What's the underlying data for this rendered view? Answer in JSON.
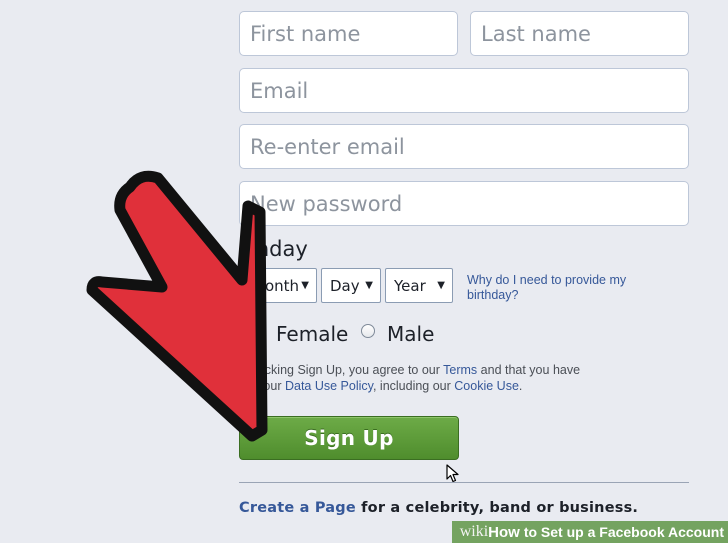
{
  "form": {
    "first_name_placeholder": "First name",
    "last_name_placeholder": "Last name",
    "email_placeholder": "Email",
    "reenter_email_placeholder": "Re-enter email",
    "password_placeholder": "New password",
    "birthday_label": "rthday",
    "birthday_selects": {
      "month": "Month",
      "day": "Day",
      "year": "Year"
    },
    "birthday_why_link": "Why do I need to provide my birthday?",
    "gender_female": "Female",
    "gender_male": "Male",
    "terms_line1_prefix": " clicking Sign Up, you agree to our ",
    "terms_link": "Terms",
    "terms_line1_suffix": " and that you have",
    "terms_line2_prefix": "d our ",
    "data_policy_link": "Data Use Policy",
    "terms_line2_middle": ", including our ",
    "cookie_link": "Cookie Use",
    "terms_line2_suffix": ".",
    "signup_button": "Sign Up",
    "create_page_link": "Create a Page",
    "create_page_suffix": " for a celebrity, band or business."
  },
  "overlay": {
    "arrow_color": "#e0303a",
    "watermark_wiki": "wiki",
    "watermark_how": "How",
    "watermark_title": "to Set up a Facebook Account"
  },
  "colors": {
    "background": "#e9ebf1",
    "link": "#365899",
    "signup_green": "#5b9a39",
    "watermark_green": "#5f9646"
  }
}
